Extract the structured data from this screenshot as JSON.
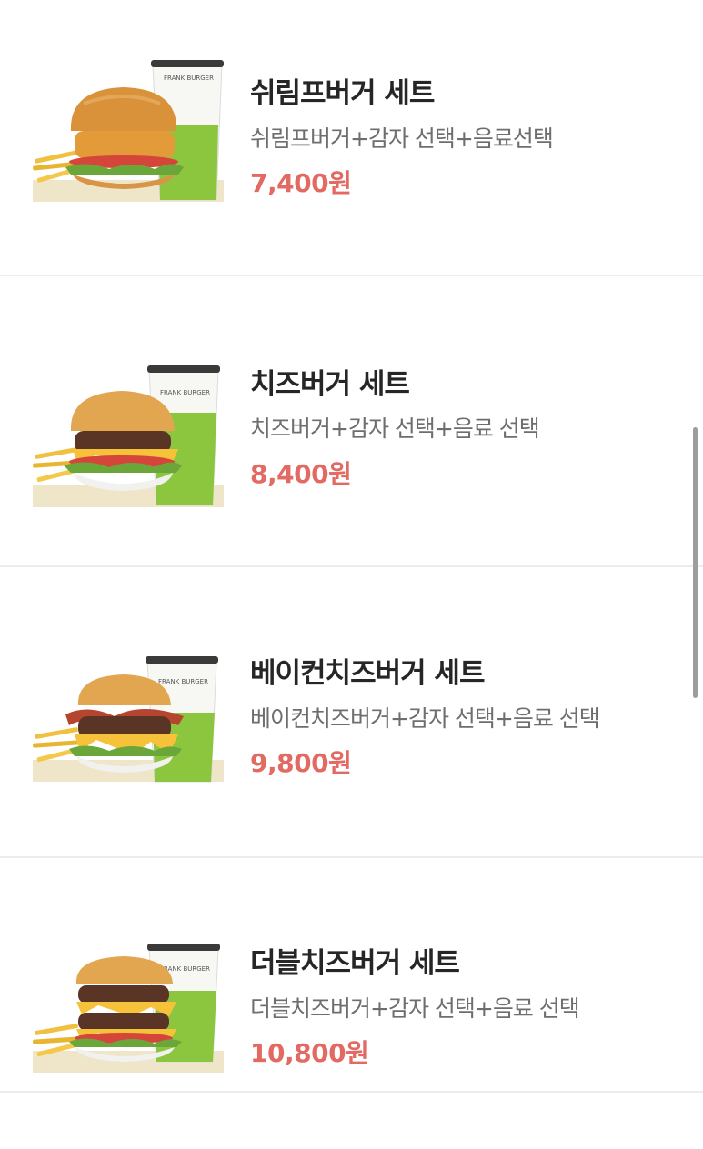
{
  "menu": {
    "items": [
      {
        "name": "쉬림프버거 세트",
        "description": "쉬림프버거+감자 선택+음료선택",
        "price": "7,400원",
        "image_alt": "shrimp-burger-set-photo",
        "cup_brand": "FRANK BURGER",
        "patty": "shrimp"
      },
      {
        "name": "치즈버거 세트",
        "description": "치즈버거+감자 선택+음료 선택",
        "price": "8,400원",
        "image_alt": "cheese-burger-set-photo",
        "cup_brand": "FRANK BURGER",
        "patty": "cheese"
      },
      {
        "name": "베이컨치즈버거 세트",
        "description": "베이컨치즈버거+감자 선택+음료 선택",
        "price": "9,800원",
        "image_alt": "bacon-cheese-burger-set-photo",
        "cup_brand": "FRANK BURGER",
        "patty": "bacon"
      },
      {
        "name": "더블치즈버거 세트",
        "description": "더블치즈버거+감자 선택+음료 선택",
        "price": "10,800원",
        "image_alt": "double-cheese-burger-set-photo",
        "cup_brand": "FRANK BURGER",
        "patty": "double"
      }
    ]
  },
  "colors": {
    "price": "#e26a63",
    "name": "#262626",
    "description": "#6e6e6e",
    "divider": "#ececec",
    "cup_green": "#8cc63f"
  }
}
